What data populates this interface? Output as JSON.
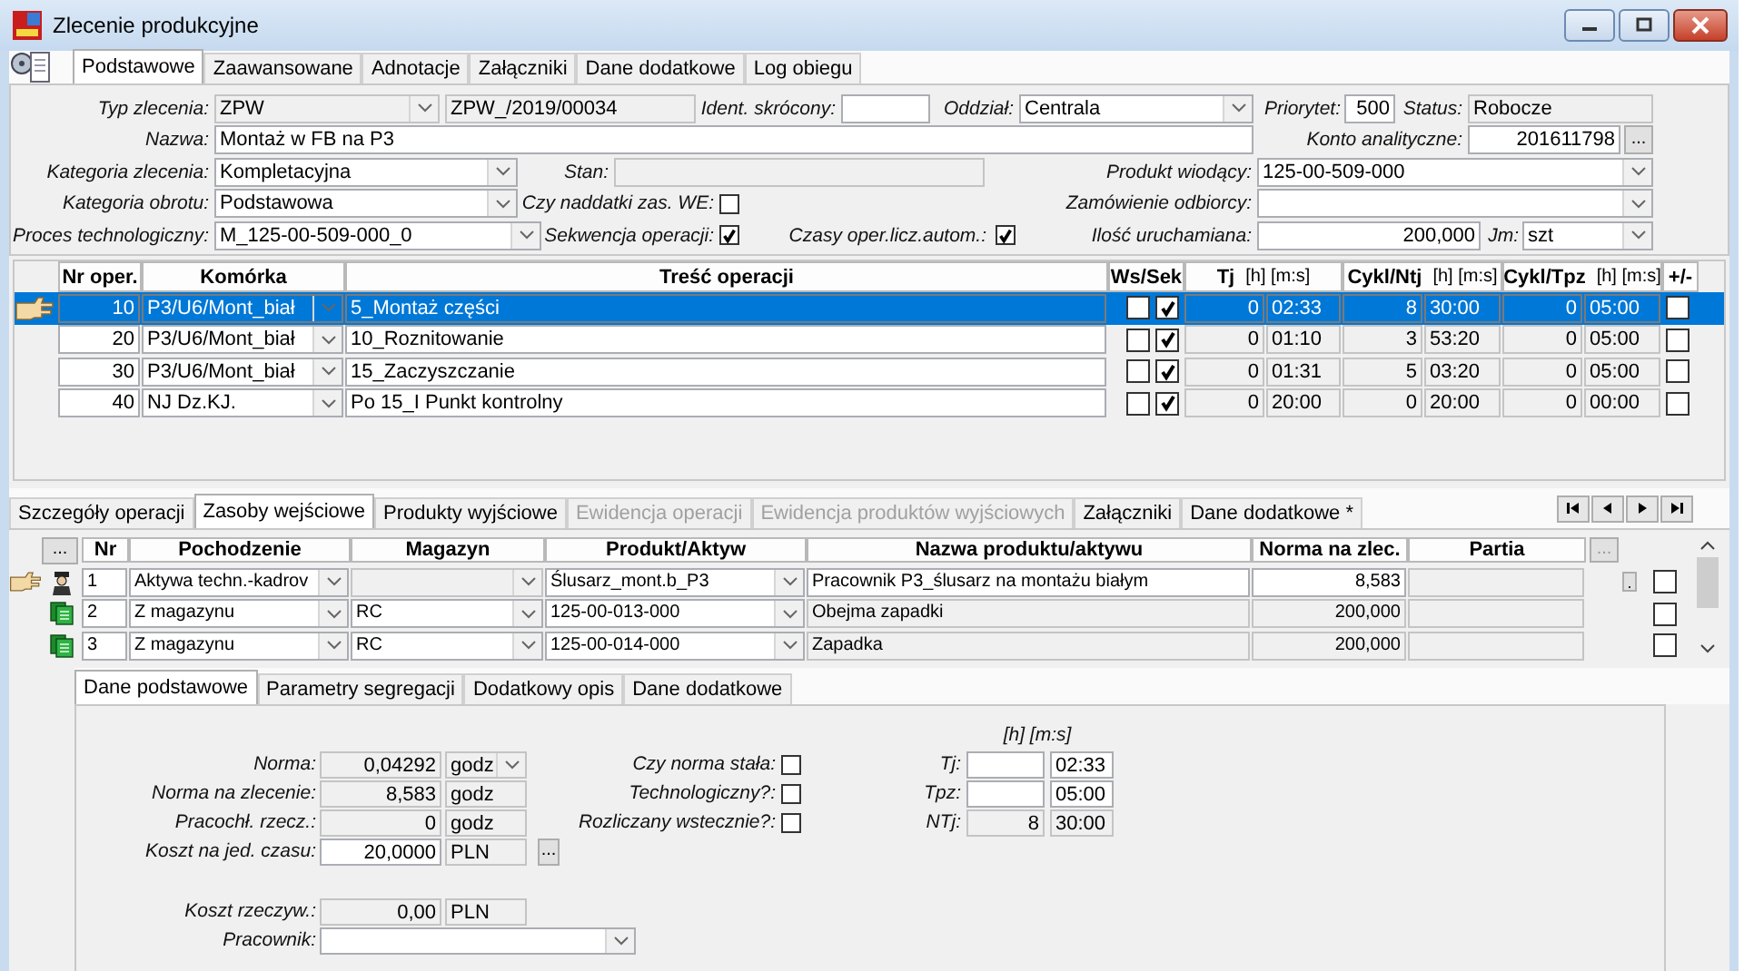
{
  "window": {
    "title": "Zlecenie produkcyjne"
  },
  "tabs": [
    {
      "label": "Podstawowe",
      "selected": true
    },
    {
      "label": "Zaawansowane",
      "selected": false
    },
    {
      "label": "Adnotacje",
      "selected": false
    },
    {
      "label": "Załączniki",
      "selected": false
    },
    {
      "label": "Dane dodatkowe",
      "selected": false
    },
    {
      "label": "Log obiegu",
      "selected": false
    }
  ],
  "form_rows": [
    [
      {
        "kind": "label",
        "text": "Typ zlecenia:"
      },
      {
        "kind": "combo-ro",
        "value": "ZPW"
      },
      {
        "kind": "readonly",
        "value": "ZPW_/2019/00034"
      },
      {
        "kind": "label",
        "text": "Ident. skrócony:"
      },
      {
        "kind": "text"
      },
      {
        "kind": "label",
        "text": "Oddział:"
      },
      {
        "kind": "combo",
        "value": "Centrala"
      },
      {
        "kind": "label",
        "text": "Priorytet:"
      },
      {
        "kind": "number",
        "value": "500"
      },
      {
        "kind": "label",
        "text": "Status:"
      },
      {
        "kind": "readonly",
        "value": "Robocze"
      }
    ],
    [
      {
        "kind": "label",
        "text": "Nazwa:"
      },
      {
        "kind": "text",
        "value": "Montaż w FB na P3"
      },
      {
        "kind": "label",
        "text": "Konto analityczne:"
      },
      {
        "kind": "number",
        "value": "201611798"
      },
      {
        "kind": "ellipsis",
        "text": "..."
      }
    ],
    [
      {
        "kind": "label",
        "text": "Kategoria zlecenia:"
      },
      {
        "kind": "combo",
        "value": "Kompletacyjna"
      },
      {
        "kind": "label",
        "text": "Stan:"
      },
      {
        "kind": "readonly"
      },
      {
        "kind": "label",
        "text": "Produkt wiodący:"
      },
      {
        "kind": "combo",
        "value": "125-00-509-000"
      }
    ],
    [
      {
        "kind": "label",
        "text": "Kategoria obrotu:"
      },
      {
        "kind": "combo",
        "value": "Podstawowa"
      },
      {
        "kind": "label",
        "text": "Czy naddatki zas. WE:"
      },
      {
        "kind": "check",
        "checked": false
      },
      {
        "kind": "label",
        "text": "Zamówienie odbiorcy:"
      },
      {
        "kind": "combo"
      }
    ],
    [
      {
        "kind": "label",
        "text": "Proces technologiczny:"
      },
      {
        "kind": "combo",
        "value": "M_125-00-509-000_0"
      },
      {
        "kind": "label",
        "text": "Sekwencja operacji:"
      },
      {
        "kind": "check",
        "checked": true
      },
      {
        "kind": "label",
        "text": "Czasy oper.licz.autom.:"
      },
      {
        "kind": "check",
        "checked": true
      },
      {
        "kind": "label",
        "text": "Ilość uruchamiana:"
      },
      {
        "kind": "number",
        "value": "200,000"
      },
      {
        "kind": "label",
        "text": "Jm:"
      },
      {
        "kind": "combo",
        "value": "szt"
      }
    ]
  ],
  "operations": {
    "columns": [
      {
        "label": "Nr oper."
      },
      {
        "label": "Komórka"
      },
      {
        "label": "Treść operacji"
      },
      {
        "label": "Ws/Sek"
      },
      {
        "label": "Tj",
        "unit": "[h] [m:s]"
      },
      {
        "label": "Cykl/Ntj",
        "unit": "[h] [m:s]"
      },
      {
        "label": "Cykl/Tpz",
        "unit": "[h] [m:s]"
      },
      {
        "label": "+/-"
      }
    ],
    "rows": [
      {
        "selected": true,
        "nr": "10",
        "komorka": "P3/U6/Mont_biał",
        "tresc": "5_Montaż części",
        "ws": false,
        "sek": true,
        "tj_h": "0",
        "tj_ms": "02:33",
        "ntj_h": "8",
        "ntj_ms": "30:00",
        "tpz_h": "0",
        "tpz_ms": "05:00",
        "plus_minus": false
      },
      {
        "selected": false,
        "nr": "20",
        "komorka": "P3/U6/Mont_biał",
        "tresc": "10_Roznitowanie",
        "ws": false,
        "sek": true,
        "tj_h": "0",
        "tj_ms": "01:10",
        "ntj_h": "3",
        "ntj_ms": "53:20",
        "tpz_h": "0",
        "tpz_ms": "05:00",
        "plus_minus": false
      },
      {
        "selected": false,
        "nr": "30",
        "komorka": "P3/U6/Mont_biał",
        "tresc": "15_Zaczyszczanie",
        "ws": false,
        "sek": true,
        "tj_h": "0",
        "tj_ms": "01:31",
        "ntj_h": "5",
        "ntj_ms": "03:20",
        "tpz_h": "0",
        "tpz_ms": "05:00",
        "plus_minus": false
      },
      {
        "selected": false,
        "nr": "40",
        "komorka": "NJ Dz.KJ.",
        "tresc": "Po 15_I Punkt kontrolny",
        "ws": false,
        "sek": true,
        "tj_h": "0",
        "tj_ms": "20:00",
        "ntj_h": "0",
        "ntj_ms": "20:00",
        "tpz_h": "0",
        "tpz_ms": "00:00",
        "plus_minus": false
      }
    ]
  },
  "lower_tabs": [
    {
      "label": "Szczegóły operacji",
      "selected": false,
      "disabled": false
    },
    {
      "label": "Zasoby wejściowe",
      "selected": true,
      "disabled": false
    },
    {
      "label": "Produkty wyjściowe",
      "selected": false,
      "disabled": false
    },
    {
      "label": "Ewidencja operacji",
      "selected": false,
      "disabled": true
    },
    {
      "label": "Ewidencja produktów wyjściowych",
      "selected": false,
      "disabled": true
    },
    {
      "label": "Załączniki",
      "selected": false,
      "disabled": false
    },
    {
      "label": "Dane dodatkowe *",
      "selected": false,
      "disabled": false
    }
  ],
  "resources": {
    "header_button": "...",
    "columns": [
      {
        "label": "Nr"
      },
      {
        "label": "Pochodzenie"
      },
      {
        "label": "Magazyn"
      },
      {
        "label": "Produkt/Aktyw"
      },
      {
        "label": "Nazwa produktu/aktywu"
      },
      {
        "label": "Norma na zlec."
      },
      {
        "label": "Partia"
      }
    ],
    "partia_button": "...",
    "rows": [
      {
        "current": true,
        "kind": "worker",
        "nr": "1",
        "pochodzenie": "Aktywa techn.-kadrov",
        "produkt": "Ślusarz_mont.b_P3",
        "nazwa": "Pracownik P3_ślusarz na montażu białym",
        "norma": "8,583",
        "button": ".",
        "checked": false
      },
      {
        "current": false,
        "kind": "stock",
        "nr": "2",
        "pochodzenie": "Z magazynu",
        "magazyn": "RC",
        "produkt": "125-00-013-000",
        "nazwa": "Obejma zapadki",
        "norma": "200,000",
        "checked": false
      },
      {
        "current": false,
        "kind": "stock",
        "nr": "3",
        "pochodzenie": "Z magazynu",
        "magazyn": "RC",
        "produkt": "125-00-014-000",
        "nazwa": "Zapadka",
        "norma": "200,000",
        "checked": false
      }
    ]
  },
  "detail_tabs": [
    {
      "label": "Dane podstawowe",
      "selected": true
    },
    {
      "label": "Parametry segregacji",
      "selected": false
    },
    {
      "label": "Dodatkowy opis",
      "selected": false
    },
    {
      "label": "Dane dodatkowe",
      "selected": false
    }
  ],
  "detail_rows": [
    [
      {
        "kind": "label",
        "text": "[h] [m:s]"
      }
    ],
    [
      {
        "kind": "label",
        "text": "Norma:"
      },
      {
        "kind": "readonly-number",
        "value": "0,04292"
      },
      {
        "kind": "combo-ro",
        "value": "godz"
      },
      {
        "kind": "label",
        "text": "Czy norma stała:"
      },
      {
        "kind": "check",
        "checked": false
      },
      {
        "kind": "label",
        "text": "Tj:"
      },
      {
        "kind": "text"
      },
      {
        "kind": "text",
        "value": "02:33"
      }
    ],
    [
      {
        "kind": "label",
        "text": "Norma na zlecenie:"
      },
      {
        "kind": "readonly-number",
        "value": "8,583"
      },
      {
        "kind": "readonly",
        "value": "godz"
      },
      {
        "kind": "label",
        "text": "Technologiczny?:"
      },
      {
        "kind": "check",
        "checked": false
      },
      {
        "kind": "label",
        "text": "Tpz:"
      },
      {
        "kind": "text"
      },
      {
        "kind": "text",
        "value": "05:00"
      }
    ],
    [
      {
        "kind": "label",
        "text": "Pracochł. rzecz.:"
      },
      {
        "kind": "readonly-number",
        "value": "0"
      },
      {
        "kind": "readonly",
        "value": "godz"
      },
      {
        "kind": "label",
        "text": "Rozliczany wstecznie?:"
      },
      {
        "kind": "check",
        "checked": false
      },
      {
        "kind": "label",
        "text": "NTj:"
      },
      {
        "kind": "readonly-number",
        "value": "8"
      },
      {
        "kind": "readonly",
        "value": "30:00"
      }
    ],
    [
      {
        "kind": "label",
        "text": "Koszt na jed. czasu:"
      },
      {
        "kind": "number",
        "value": "20,0000"
      },
      {
        "kind": "readonly",
        "value": "PLN"
      },
      {
        "kind": "ellipsis",
        "text": "..."
      }
    ],
    [
      {
        "kind": "label",
        "text": "Koszt rzeczyw.:"
      },
      {
        "kind": "readonly-number",
        "value": "0,00"
      },
      {
        "kind": "readonly",
        "value": "PLN"
      }
    ],
    [
      {
        "kind": "label",
        "text": "Pracownik:"
      },
      {
        "kind": "combo"
      }
    ]
  ]
}
